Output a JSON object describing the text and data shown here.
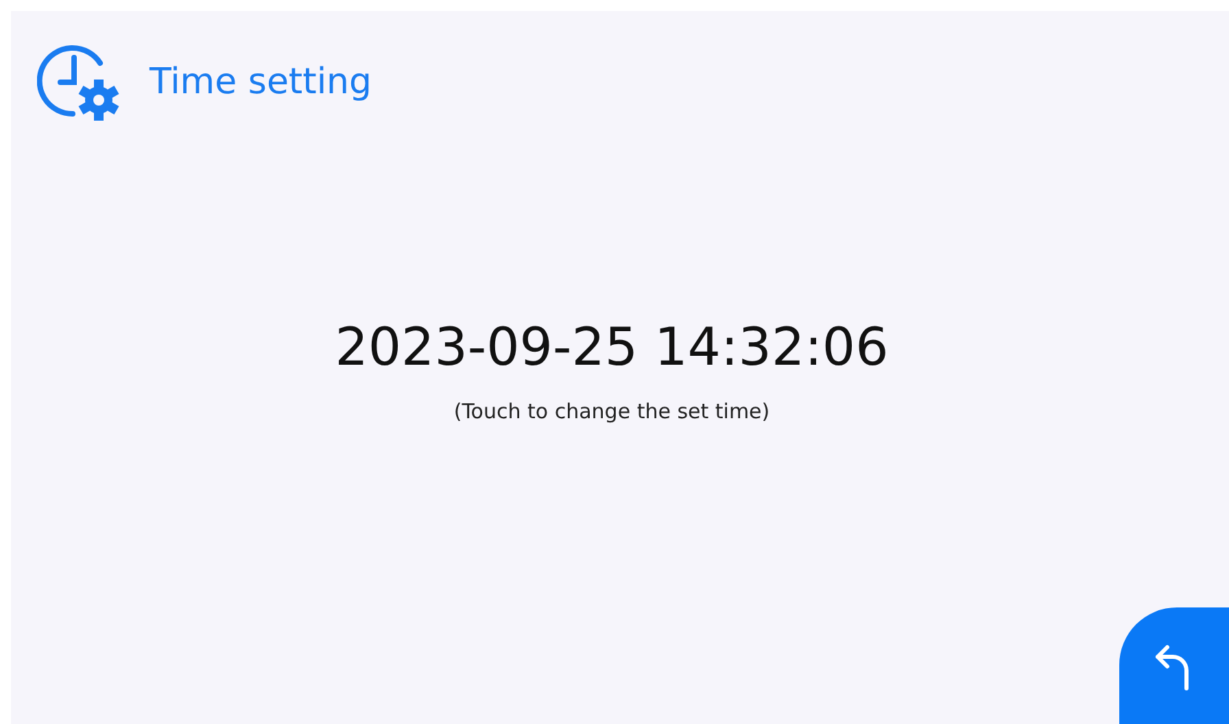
{
  "header": {
    "title": "Time setting"
  },
  "datetime": {
    "value": "2023-09-25 14:32:06",
    "hint": "(Touch to change the set time)"
  }
}
